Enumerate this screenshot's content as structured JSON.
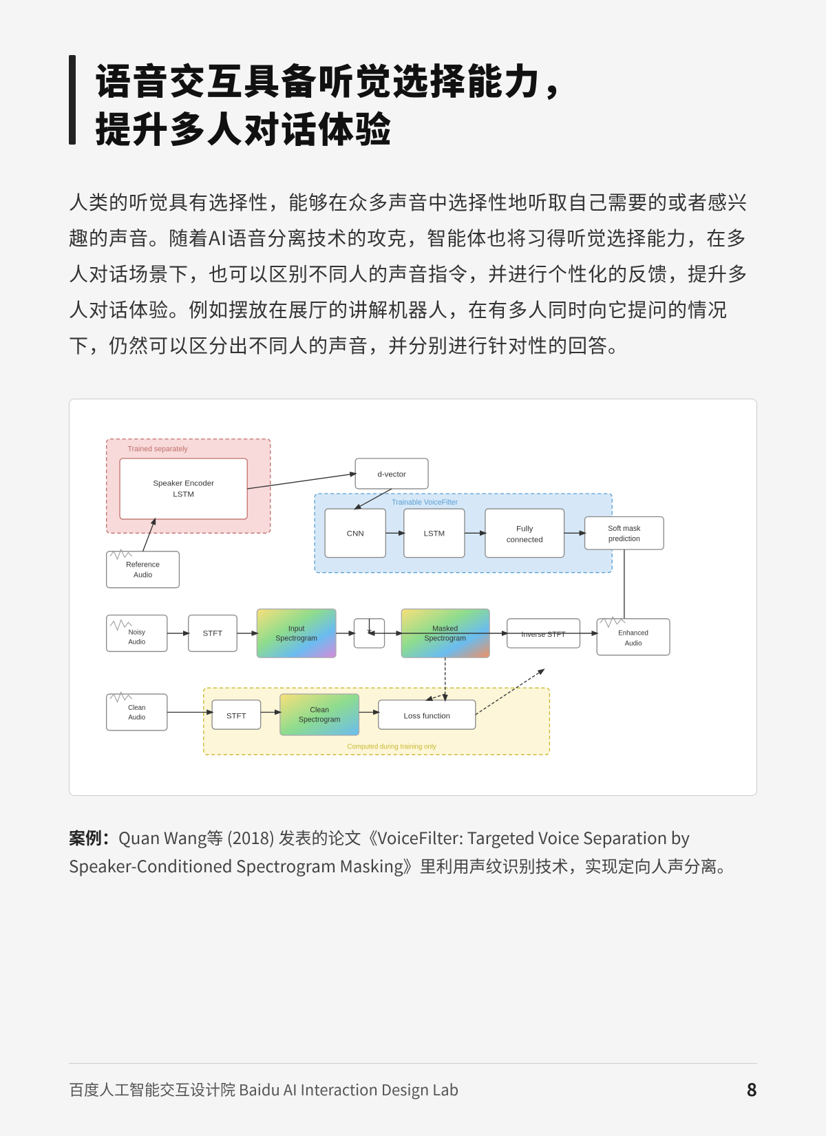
{
  "title": "语音交互具备听觉选择能力，\n提升多人对话体验",
  "body": "人类的听觉具有选择性，能够在众多声音中选择性地听取自己需要的或者感兴趣的声音。随着AI语音分离技术的攻克，智能体也将习得听觉选择能力，在多人对话场景下，也可以区别不同人的声音指令，并进行个性化的反馈，提升多人对话体验。例如摆放在展厅的讲解机器人，在有多人同时向它提问的情况下，仍然可以区分出不同人的声音，并分别进行针对性的回答。",
  "caption": {
    "prefix": "案例：",
    "text": "Quan Wang等 (2018) 发表的论文《VoiceFilter: Targeted Voice Separation by Speaker-Conditioned Spectrogram Masking》里利用声纹识别技术，实现定向人声分离。"
  },
  "footer": {
    "left": "百度人工智能交互设计院  Baidu AI Interaction Design Lab",
    "page": "8"
  },
  "diagram": {
    "trained_separately": "Trained separately",
    "speaker_encoder_lstm": "Speaker Encoder LSTM",
    "d_vector": "d-vector",
    "trainable_voicefilter": "Trainable VoiceFilter",
    "cnn": "CNN",
    "lstm": "LSTM",
    "fully_connected": "Fully connected",
    "soft_mask": "Soft mask prediction",
    "reference_audio": "Reference Audio",
    "noisy_audio": "Noisy Audio",
    "stft1": "STFT",
    "input_spectrogram": "Input Spectrogram",
    "multiply": "*",
    "masked_spectrogram": "Masked Spectrogram",
    "inverse_stft": "Inverse STFT",
    "clean_audio": "Clean Audio",
    "stft2": "STFT",
    "clean_spectrogram": "Clean Spectrogram",
    "loss_function": "Loss function",
    "enhanced_audio": "Enhanced Audio",
    "computed_during": "Computed during training only"
  }
}
